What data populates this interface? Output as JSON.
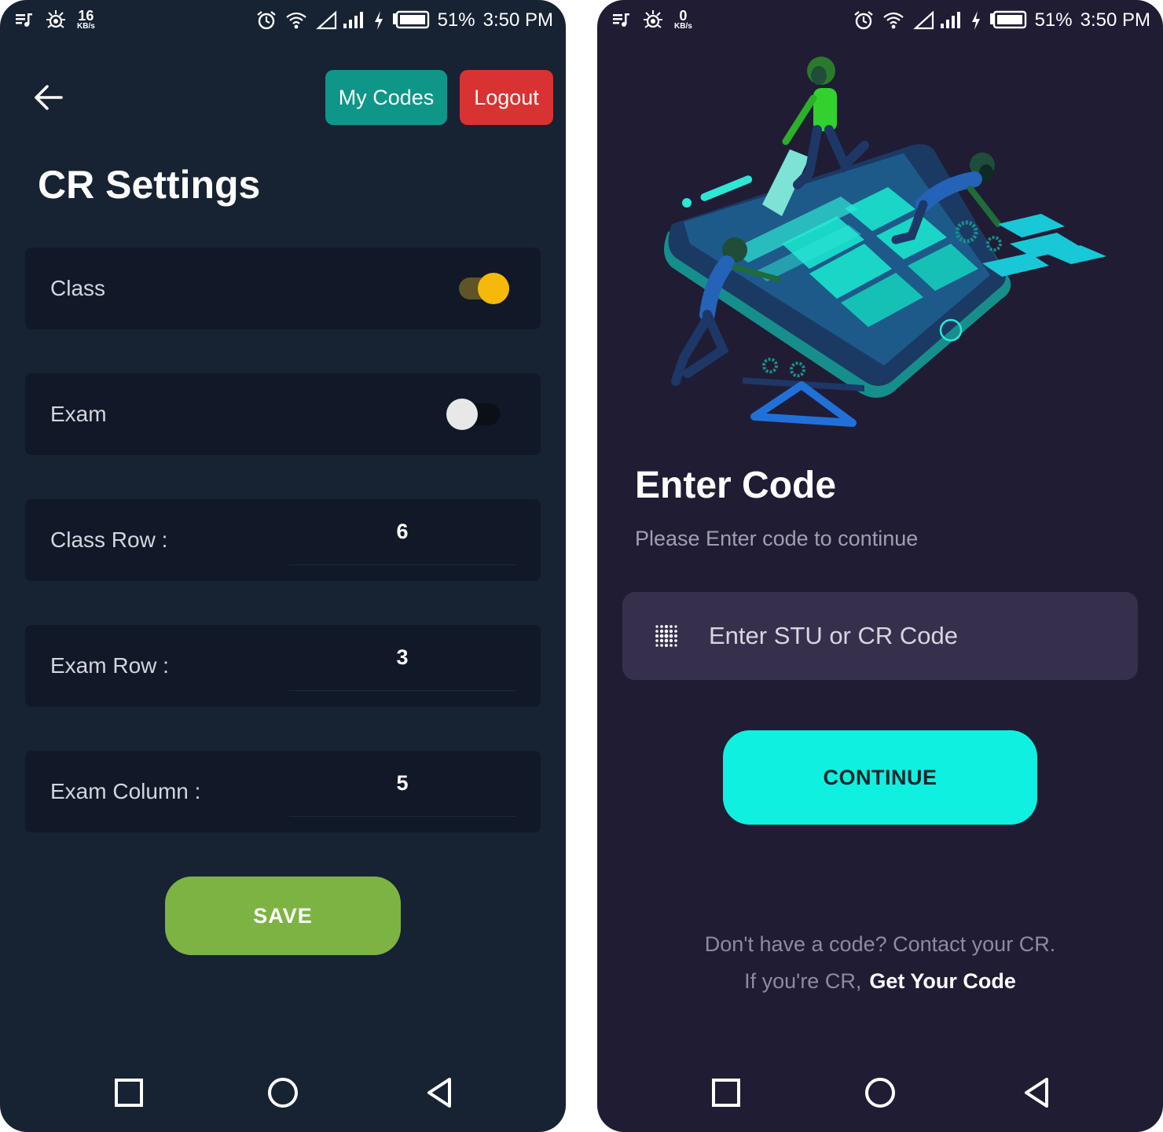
{
  "status_bar_left": {
    "kbps": "16",
    "kbps_unit": "KB/s",
    "battery": "51%",
    "time": "3:50 PM"
  },
  "status_bar_right": {
    "kbps": "0",
    "kbps_unit": "KB/s",
    "battery": "51%",
    "time": "3:50 PM"
  },
  "settings": {
    "my_codes_label": "My Codes",
    "logout_label": "Logout",
    "title": "CR Settings",
    "toggles": [
      {
        "label": "Class",
        "on": true
      },
      {
        "label": "Exam",
        "on": false
      }
    ],
    "fields": [
      {
        "label": "Class Row :",
        "value": "6"
      },
      {
        "label": "Exam Row :",
        "value": "3"
      },
      {
        "label": "Exam Column :",
        "value": "5"
      }
    ],
    "save_label": "SAVE"
  },
  "enter_code": {
    "title": "Enter Code",
    "subtitle": "Please Enter code to continue",
    "input_placeholder": "Enter STU or CR Code",
    "continue_label": "CONTINUE",
    "help_line": "Don't have a code? Contact your CR.",
    "cr_prefix": "If you're CR,",
    "get_code_label": "Get Your Code"
  },
  "colors": {
    "left_bg": "#172233",
    "right_bg": "#201c34",
    "card_bg": "#111827",
    "my_codes": "#0e9688",
    "logout": "#d93232",
    "save": "#7db343",
    "continue": "#0ff0e0",
    "toggle_on": "#f5b90a",
    "input_bg": "#37304d"
  },
  "icons": [
    "back-arrow-icon",
    "music-note-icon",
    "bug-icon",
    "alarm-icon",
    "wifi-icon",
    "signal-icon",
    "charging-icon",
    "battery-icon",
    "keypad-icon",
    "recents-icon",
    "home-icon",
    "back-triangle-icon"
  ]
}
